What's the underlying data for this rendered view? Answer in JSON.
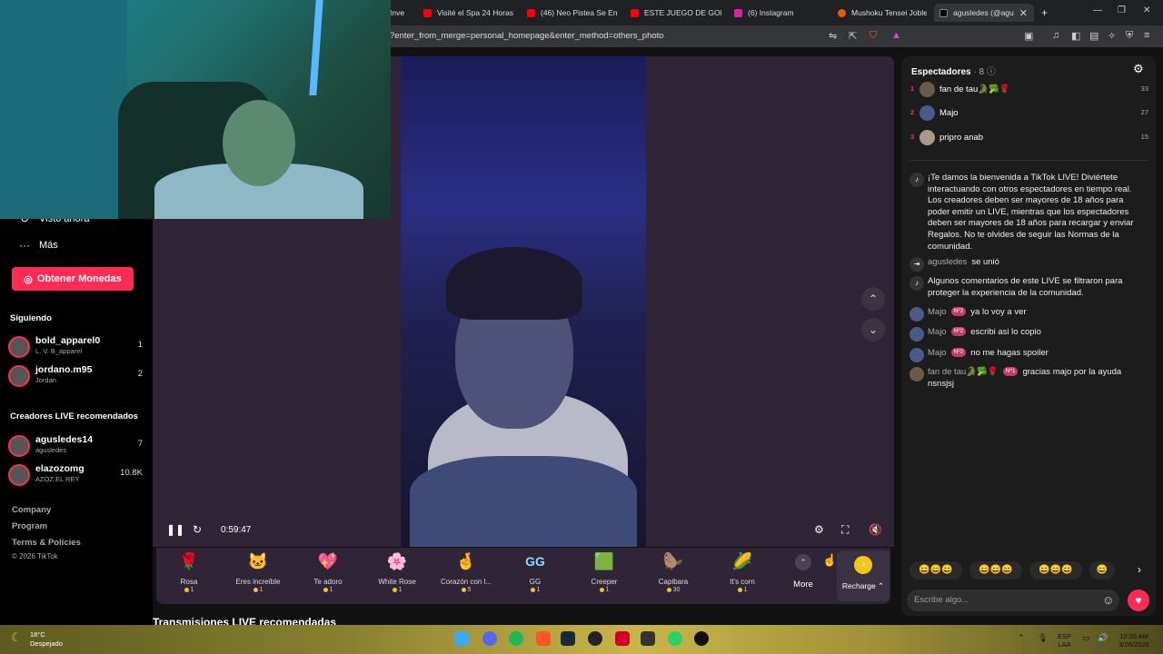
{
  "browser": {
    "tabs": [
      {
        "label": "Inve",
        "color": "#555"
      },
      {
        "label": "Visité el Spa 24 Horas",
        "color": "#ff0000"
      },
      {
        "label": "(46) Neo Pistea Se Enf",
        "color": "#ff0000"
      },
      {
        "label": "ESTE JUEGO DE GOLF",
        "color": "#ff0000"
      },
      {
        "label": "(6) Instagram",
        "color": "#d6249f"
      },
      {
        "label": "Mushoku Tensei Jobles",
        "color": "#e8590c"
      },
      {
        "label": "agusledes (@agu",
        "color": "#000000"
      }
    ],
    "url": "?enter_from_merge=personal_homepage&enter_method=others_photo"
  },
  "sidebar": {
    "visto_ahora": "Visto ahora",
    "mas": "Más",
    "coins_button": "Obtener Monedas",
    "following_title": "Siguiendo",
    "following": [
      {
        "name": "bold_apparel0",
        "sub": "L. V. B_apparel",
        "count": "1"
      },
      {
        "name": "jordano.m95",
        "sub": "Jordan",
        "count": "2"
      }
    ],
    "recommended_title": "Creadores LIVE recomendados",
    "recommended": [
      {
        "name": "agusledes14",
        "sub": "agusledes",
        "count": "7"
      },
      {
        "name": "elazozomg",
        "sub": "AZOZ EL REY",
        "count": "10.8K"
      }
    ],
    "footer": [
      "Company",
      "Program",
      "Terms & Policies"
    ],
    "copyright": "© 2026 TikTok"
  },
  "player": {
    "time": "0:59:47",
    "gifts": [
      {
        "name": "Rosa",
        "price": "1",
        "icon": "🌹"
      },
      {
        "name": "Eres increíble",
        "price": "1",
        "icon": "🐱"
      },
      {
        "name": "Te adoro",
        "price": "1",
        "icon": "💖"
      },
      {
        "name": "White Rose",
        "price": "1",
        "icon": "🌸"
      },
      {
        "name": "Corazón con l...",
        "price": "5",
        "icon": "🤞"
      },
      {
        "name": "GG",
        "price": "1",
        "icon": "GG"
      },
      {
        "name": "Creeper",
        "price": "1",
        "icon": "🟩"
      },
      {
        "name": "Capibara",
        "price": "30",
        "icon": "🦫"
      },
      {
        "name": "It's corn",
        "price": "1",
        "icon": "🌽"
      }
    ],
    "more_label": "More",
    "recharge_label": "Recharge"
  },
  "recommended_streams_title": "Transmisiones LIVE recomendadas",
  "viewers": {
    "title": "Espectadores",
    "count": "· 8",
    "ranking": [
      {
        "rank": "1",
        "name": "fan de tau🐊🥦🌹",
        "score": "33"
      },
      {
        "rank": "2",
        "name": "Majo",
        "score": "27"
      },
      {
        "rank": "3",
        "name": "pripro anab",
        "score": "15"
      }
    ]
  },
  "chat": {
    "welcome": "¡Te damos la bienvenida a TikTok LIVE! Diviértete interactuando con otros espectadores en tiempo real. Los creadores deben ser mayores de 18 años para poder emitir un LIVE, mientras que los espectadores deben ser mayores de 18 años para recargar y enviar Regalos. No te olvides de seguir las Normas de la comunidad.",
    "joined_user": "agusledes",
    "joined_text": "se unió",
    "filtered": "Algunos comentarios de este LIVE se filtraron para proteger la experiencia de la comunidad.",
    "messages": [
      {
        "user": "Majo",
        "badge": "Nº2",
        "text": "ya lo voy a ver"
      },
      {
        "user": "Majo",
        "badge": "Nº2",
        "text": "escribi asi lo copio"
      },
      {
        "user": "Majo",
        "badge": "Nº2",
        "text": "no me hagas spoiler"
      },
      {
        "user": "fan de tau🐊🥦🌹",
        "badge": "Nº1",
        "text": "gracias majo por la ayuda nsnsjsj"
      }
    ],
    "emoji_chips": [
      "😄😄😄",
      "😄😄😄",
      "😄😄😄",
      "😄"
    ],
    "input_placeholder": "Escribe algo..."
  },
  "taskbar": {
    "temp": "18°C",
    "weather": "Despejado",
    "lang": "ESP",
    "lang2": "LAA",
    "time": "12:20 AM",
    "date": "3/26/2026"
  }
}
